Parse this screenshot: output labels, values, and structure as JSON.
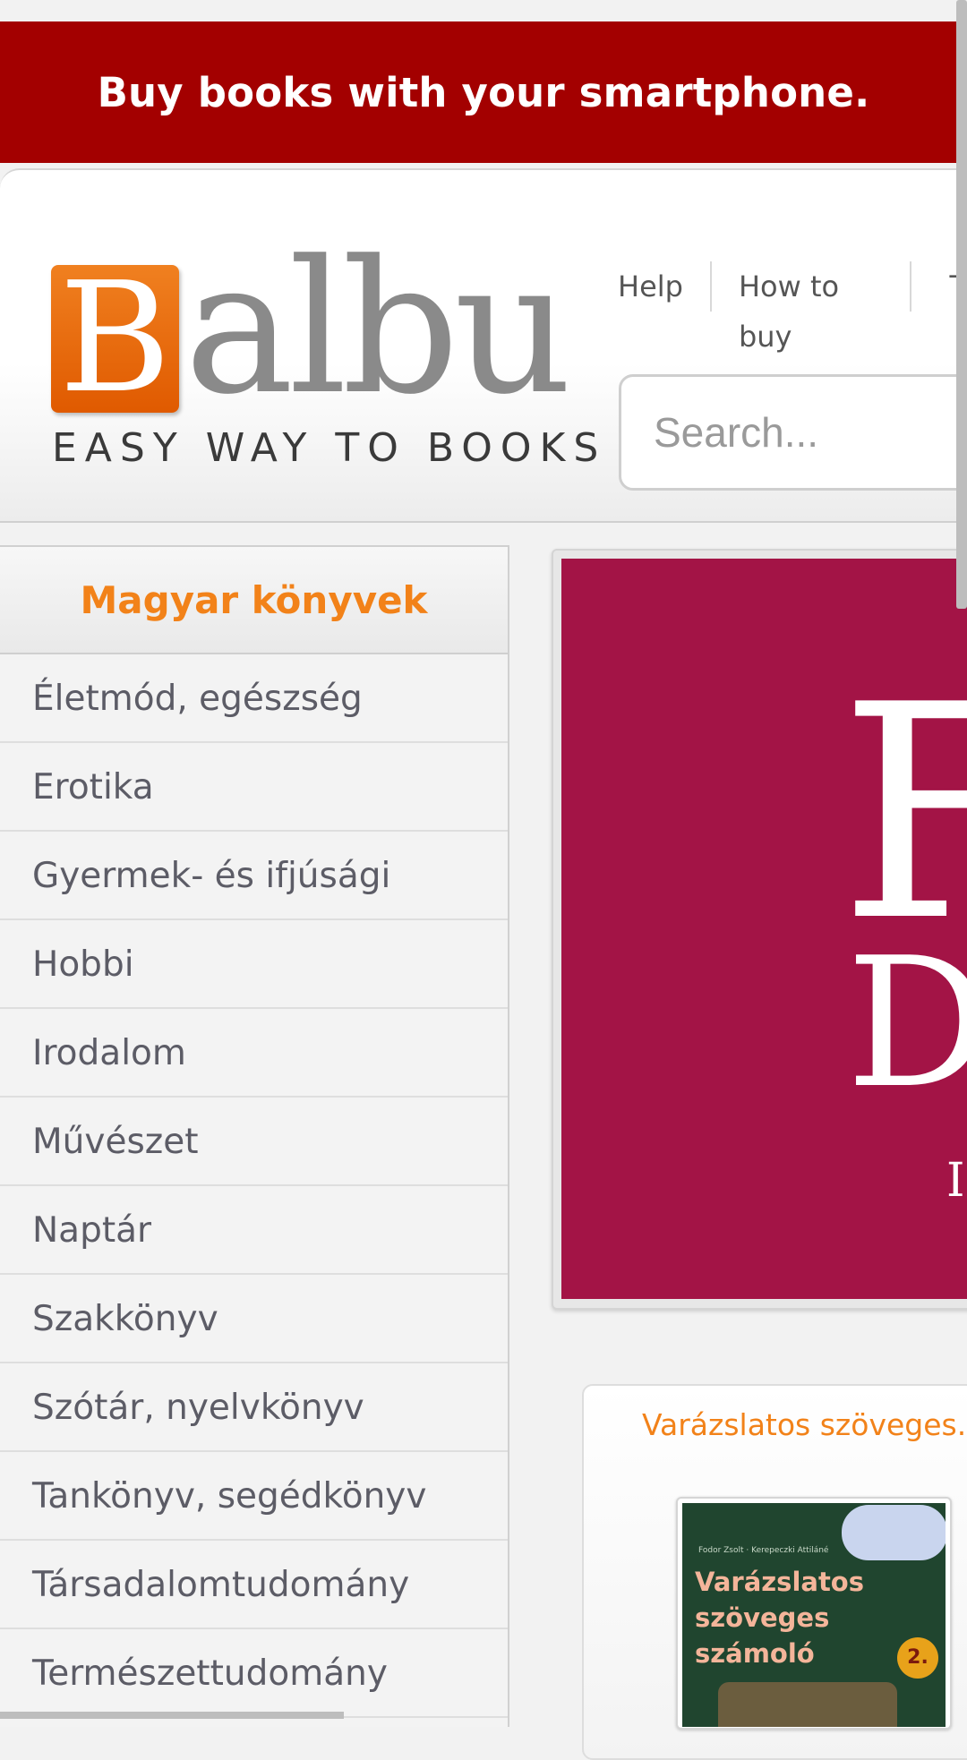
{
  "promo": {
    "text": "Buy books with your smartphone."
  },
  "brand": {
    "logo_letter": "B",
    "logo_rest": "albu",
    "tagline": "EASY WAY TO BOOKS",
    "accent": "#f28219",
    "promo_bg": "#a30000"
  },
  "top_links": [
    {
      "label": "Help"
    },
    {
      "label": "How to buy"
    },
    {
      "label": "T"
    }
  ],
  "search": {
    "placeholder": "Search..."
  },
  "sidebar": {
    "title": "Magyar könyvek",
    "categories": [
      "Életmód, egészség",
      "Erotika",
      "Gyermek- és ifjúsági",
      "Hobbi",
      "Irodalom",
      "Művészet",
      "Naptár",
      "Szakkönyv",
      "Szótár, nyelvkönyv",
      "Tankönyv, segédkönyv",
      "Társadalomtudomány",
      "Természettudomány"
    ]
  },
  "banner": {
    "bg": "#a31446",
    "glyphs": [
      "F",
      "D",
      "I"
    ]
  },
  "featured": {
    "title": "Varázslatos szöveges...",
    "cover": {
      "author": "Fodor Zsolt · Kerepeczki Attiláné",
      "title": "Varázslatos szöveges számoló",
      "badge": "2."
    }
  }
}
